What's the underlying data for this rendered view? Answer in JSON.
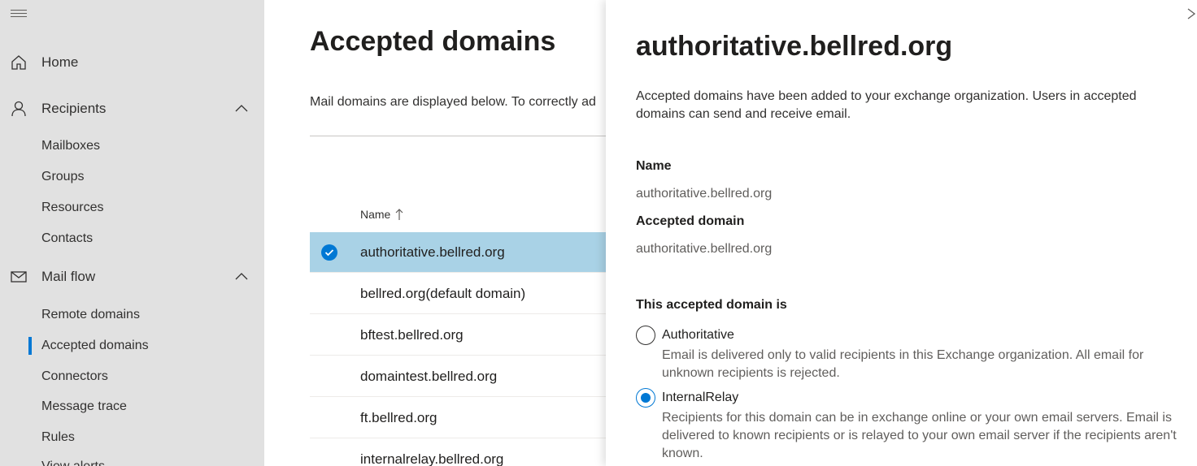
{
  "sidebar": {
    "home": "Home",
    "recipients": "Recipients",
    "recipients_items": [
      "Mailboxes",
      "Groups",
      "Resources",
      "Contacts"
    ],
    "mail_flow": "Mail flow",
    "mail_flow_items": [
      "Remote domains",
      "Accepted domains",
      "Connectors",
      "Message trace",
      "Rules",
      "View alerts"
    ],
    "active_item": "Accepted domains"
  },
  "main": {
    "title": "Accepted domains",
    "description": "Mail domains are displayed below. To correctly ad",
    "column_name": "Name",
    "rows": [
      "authoritative.bellred.org",
      "bellred.org(default domain)",
      "bftest.bellred.org",
      "domaintest.bellred.org",
      "ft.bellred.org",
      "internalrelay.bellred.org"
    ],
    "selected_row": 0
  },
  "panel": {
    "title": "authoritative.bellred.org",
    "description": "Accepted domains have been added to your exchange organization. Users in accepted domains can send and receive email.",
    "name_label": "Name",
    "name_value": "authoritative.bellred.org",
    "accepted_label": "Accepted domain",
    "accepted_value": "authoritative.bellred.org",
    "type_label": "This accepted domain is",
    "options": [
      {
        "label": "Authoritative",
        "desc": "Email is delivered only to valid recipients in this Exchange organization. All email for unknown recipients is rejected.",
        "checked": false
      },
      {
        "label": "InternalRelay",
        "desc": "Recipients for this domain can be in exchange online or your own email servers. Email is delivered to known recipients or is relayed to your own email server if the recipients aren't known.",
        "checked": true
      }
    ]
  },
  "colors": {
    "accent": "#0078d4",
    "selected_row": "#a9d2e6",
    "sidebar_bg": "#e1e1e1"
  }
}
